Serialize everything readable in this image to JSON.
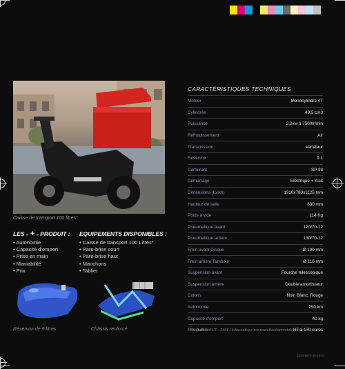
{
  "colorbar": [
    "#ffe500",
    "#e0007a",
    "#00a0e0",
    "#000000",
    "#f0ea6a",
    "#e98bb8",
    "#6dc8ee",
    "#6a6a6a",
    "#f7f3b8",
    "#f3c6dc",
    "#bde3f6",
    "#c2c2c2"
  ],
  "photo_caption": "Caisse de transport 100 litres*",
  "specs": {
    "title": "CARACTÉRISTIQUES TECHNIQUES",
    "rows": [
      {
        "label": "Moteur",
        "value": "Monocylindre 4T"
      },
      {
        "label": "Cylindrée",
        "value": "49,5 cm3"
      },
      {
        "label": "Puissance",
        "value": "2,2kw à 7500tr/min"
      },
      {
        "label": "Refroidissement",
        "value": "Air"
      },
      {
        "label": "Transmission",
        "value": "Variateur"
      },
      {
        "label": "Réservoir",
        "value": "9 L"
      },
      {
        "label": "Carburant",
        "value": "SP 98"
      },
      {
        "label": "Démarrage",
        "value": "Electrique + Kick"
      },
      {
        "label": "Dimensions (Lxlxh)",
        "value": "1910x780x1125 mm"
      },
      {
        "label": "Hauteur de selle",
        "value": "830 mm"
      },
      {
        "label": "Poids à vide",
        "value": "114 Kg"
      },
      {
        "label": "Pneumatique avant",
        "value": "120/70-12"
      },
      {
        "label": "Pneumatique arrière",
        "value": "130/70-12"
      },
      {
        "label": "Frein avant Disque",
        "value": "Ø 190 mm"
      },
      {
        "label": "Frein arrière Tambour",
        "value": "Ø 110 mm"
      },
      {
        "label": "Suspension avant",
        "value": "Fourche télescopique"
      },
      {
        "label": "Suspension arrière",
        "value": "Double amortisseur"
      },
      {
        "label": "Coloris",
        "value": "Noir, Blanc, Rouge"
      },
      {
        "label": "Autonomie",
        "value": "250 km"
      },
      {
        "label": "Capacité d'emport",
        "value": "40 kg"
      },
      {
        "label": "Prix public",
        "value": "HT 1 170 euros"
      }
    ]
  },
  "les_plus": {
    "title_prefix": "LES",
    "title_small_left": "«",
    "title_plus": "+",
    "title_small_right": "»",
    "title_suffix": "PRODUIT :",
    "items": [
      "• Autonomie",
      "• Capacité d'emport",
      "• Prise en main",
      "• Maniabilité",
      "• Prix"
    ]
  },
  "equipements": {
    "title": "EQUIPEMENTS DISPONIBLES :",
    "items": [
      "• Caisse de transport 100 Litres*",
      "• Pare-brise court",
      "• Pare-brise haut",
      "• Manchons",
      "• Tablier"
    ]
  },
  "thumbs": [
    {
      "caption": "Réservoir de 9 litres"
    },
    {
      "caption": "Châssis renforcé"
    }
  ],
  "footnote": "* Prix indicatif HT - 148€ / Informations sur www.baotianmotofrance.com",
  "slug": "1234-5678   05-10-11"
}
